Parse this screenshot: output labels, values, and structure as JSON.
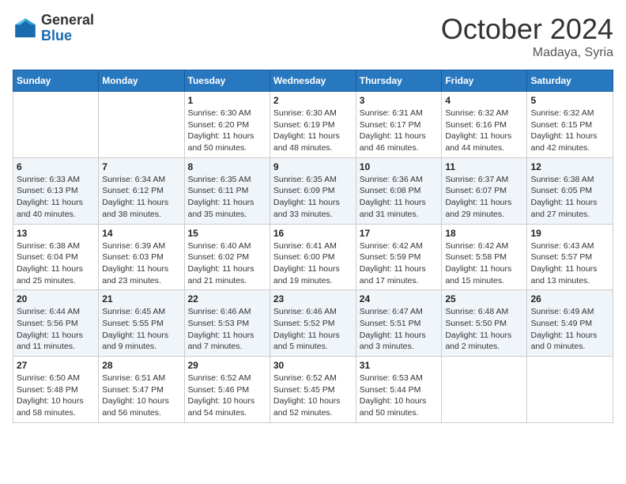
{
  "logo": {
    "text_general": "General",
    "text_blue": "Blue"
  },
  "title": "October 2024",
  "location": "Madaya, Syria",
  "days_of_week": [
    "Sunday",
    "Monday",
    "Tuesday",
    "Wednesday",
    "Thursday",
    "Friday",
    "Saturday"
  ],
  "weeks": [
    [
      {
        "day": "",
        "info": ""
      },
      {
        "day": "",
        "info": ""
      },
      {
        "day": "1",
        "info": "Sunrise: 6:30 AM\nSunset: 6:20 PM\nDaylight: 11 hours and 50 minutes."
      },
      {
        "day": "2",
        "info": "Sunrise: 6:30 AM\nSunset: 6:19 PM\nDaylight: 11 hours and 48 minutes."
      },
      {
        "day": "3",
        "info": "Sunrise: 6:31 AM\nSunset: 6:17 PM\nDaylight: 11 hours and 46 minutes."
      },
      {
        "day": "4",
        "info": "Sunrise: 6:32 AM\nSunset: 6:16 PM\nDaylight: 11 hours and 44 minutes."
      },
      {
        "day": "5",
        "info": "Sunrise: 6:32 AM\nSunset: 6:15 PM\nDaylight: 11 hours and 42 minutes."
      }
    ],
    [
      {
        "day": "6",
        "info": "Sunrise: 6:33 AM\nSunset: 6:13 PM\nDaylight: 11 hours and 40 minutes."
      },
      {
        "day": "7",
        "info": "Sunrise: 6:34 AM\nSunset: 6:12 PM\nDaylight: 11 hours and 38 minutes."
      },
      {
        "day": "8",
        "info": "Sunrise: 6:35 AM\nSunset: 6:11 PM\nDaylight: 11 hours and 35 minutes."
      },
      {
        "day": "9",
        "info": "Sunrise: 6:35 AM\nSunset: 6:09 PM\nDaylight: 11 hours and 33 minutes."
      },
      {
        "day": "10",
        "info": "Sunrise: 6:36 AM\nSunset: 6:08 PM\nDaylight: 11 hours and 31 minutes."
      },
      {
        "day": "11",
        "info": "Sunrise: 6:37 AM\nSunset: 6:07 PM\nDaylight: 11 hours and 29 minutes."
      },
      {
        "day": "12",
        "info": "Sunrise: 6:38 AM\nSunset: 6:05 PM\nDaylight: 11 hours and 27 minutes."
      }
    ],
    [
      {
        "day": "13",
        "info": "Sunrise: 6:38 AM\nSunset: 6:04 PM\nDaylight: 11 hours and 25 minutes."
      },
      {
        "day": "14",
        "info": "Sunrise: 6:39 AM\nSunset: 6:03 PM\nDaylight: 11 hours and 23 minutes."
      },
      {
        "day": "15",
        "info": "Sunrise: 6:40 AM\nSunset: 6:02 PM\nDaylight: 11 hours and 21 minutes."
      },
      {
        "day": "16",
        "info": "Sunrise: 6:41 AM\nSunset: 6:00 PM\nDaylight: 11 hours and 19 minutes."
      },
      {
        "day": "17",
        "info": "Sunrise: 6:42 AM\nSunset: 5:59 PM\nDaylight: 11 hours and 17 minutes."
      },
      {
        "day": "18",
        "info": "Sunrise: 6:42 AM\nSunset: 5:58 PM\nDaylight: 11 hours and 15 minutes."
      },
      {
        "day": "19",
        "info": "Sunrise: 6:43 AM\nSunset: 5:57 PM\nDaylight: 11 hours and 13 minutes."
      }
    ],
    [
      {
        "day": "20",
        "info": "Sunrise: 6:44 AM\nSunset: 5:56 PM\nDaylight: 11 hours and 11 minutes."
      },
      {
        "day": "21",
        "info": "Sunrise: 6:45 AM\nSunset: 5:55 PM\nDaylight: 11 hours and 9 minutes."
      },
      {
        "day": "22",
        "info": "Sunrise: 6:46 AM\nSunset: 5:53 PM\nDaylight: 11 hours and 7 minutes."
      },
      {
        "day": "23",
        "info": "Sunrise: 6:46 AM\nSunset: 5:52 PM\nDaylight: 11 hours and 5 minutes."
      },
      {
        "day": "24",
        "info": "Sunrise: 6:47 AM\nSunset: 5:51 PM\nDaylight: 11 hours and 3 minutes."
      },
      {
        "day": "25",
        "info": "Sunrise: 6:48 AM\nSunset: 5:50 PM\nDaylight: 11 hours and 2 minutes."
      },
      {
        "day": "26",
        "info": "Sunrise: 6:49 AM\nSunset: 5:49 PM\nDaylight: 11 hours and 0 minutes."
      }
    ],
    [
      {
        "day": "27",
        "info": "Sunrise: 6:50 AM\nSunset: 5:48 PM\nDaylight: 10 hours and 58 minutes."
      },
      {
        "day": "28",
        "info": "Sunrise: 6:51 AM\nSunset: 5:47 PM\nDaylight: 10 hours and 56 minutes."
      },
      {
        "day": "29",
        "info": "Sunrise: 6:52 AM\nSunset: 5:46 PM\nDaylight: 10 hours and 54 minutes."
      },
      {
        "day": "30",
        "info": "Sunrise: 6:52 AM\nSunset: 5:45 PM\nDaylight: 10 hours and 52 minutes."
      },
      {
        "day": "31",
        "info": "Sunrise: 6:53 AM\nSunset: 5:44 PM\nDaylight: 10 hours and 50 minutes."
      },
      {
        "day": "",
        "info": ""
      },
      {
        "day": "",
        "info": ""
      }
    ]
  ]
}
